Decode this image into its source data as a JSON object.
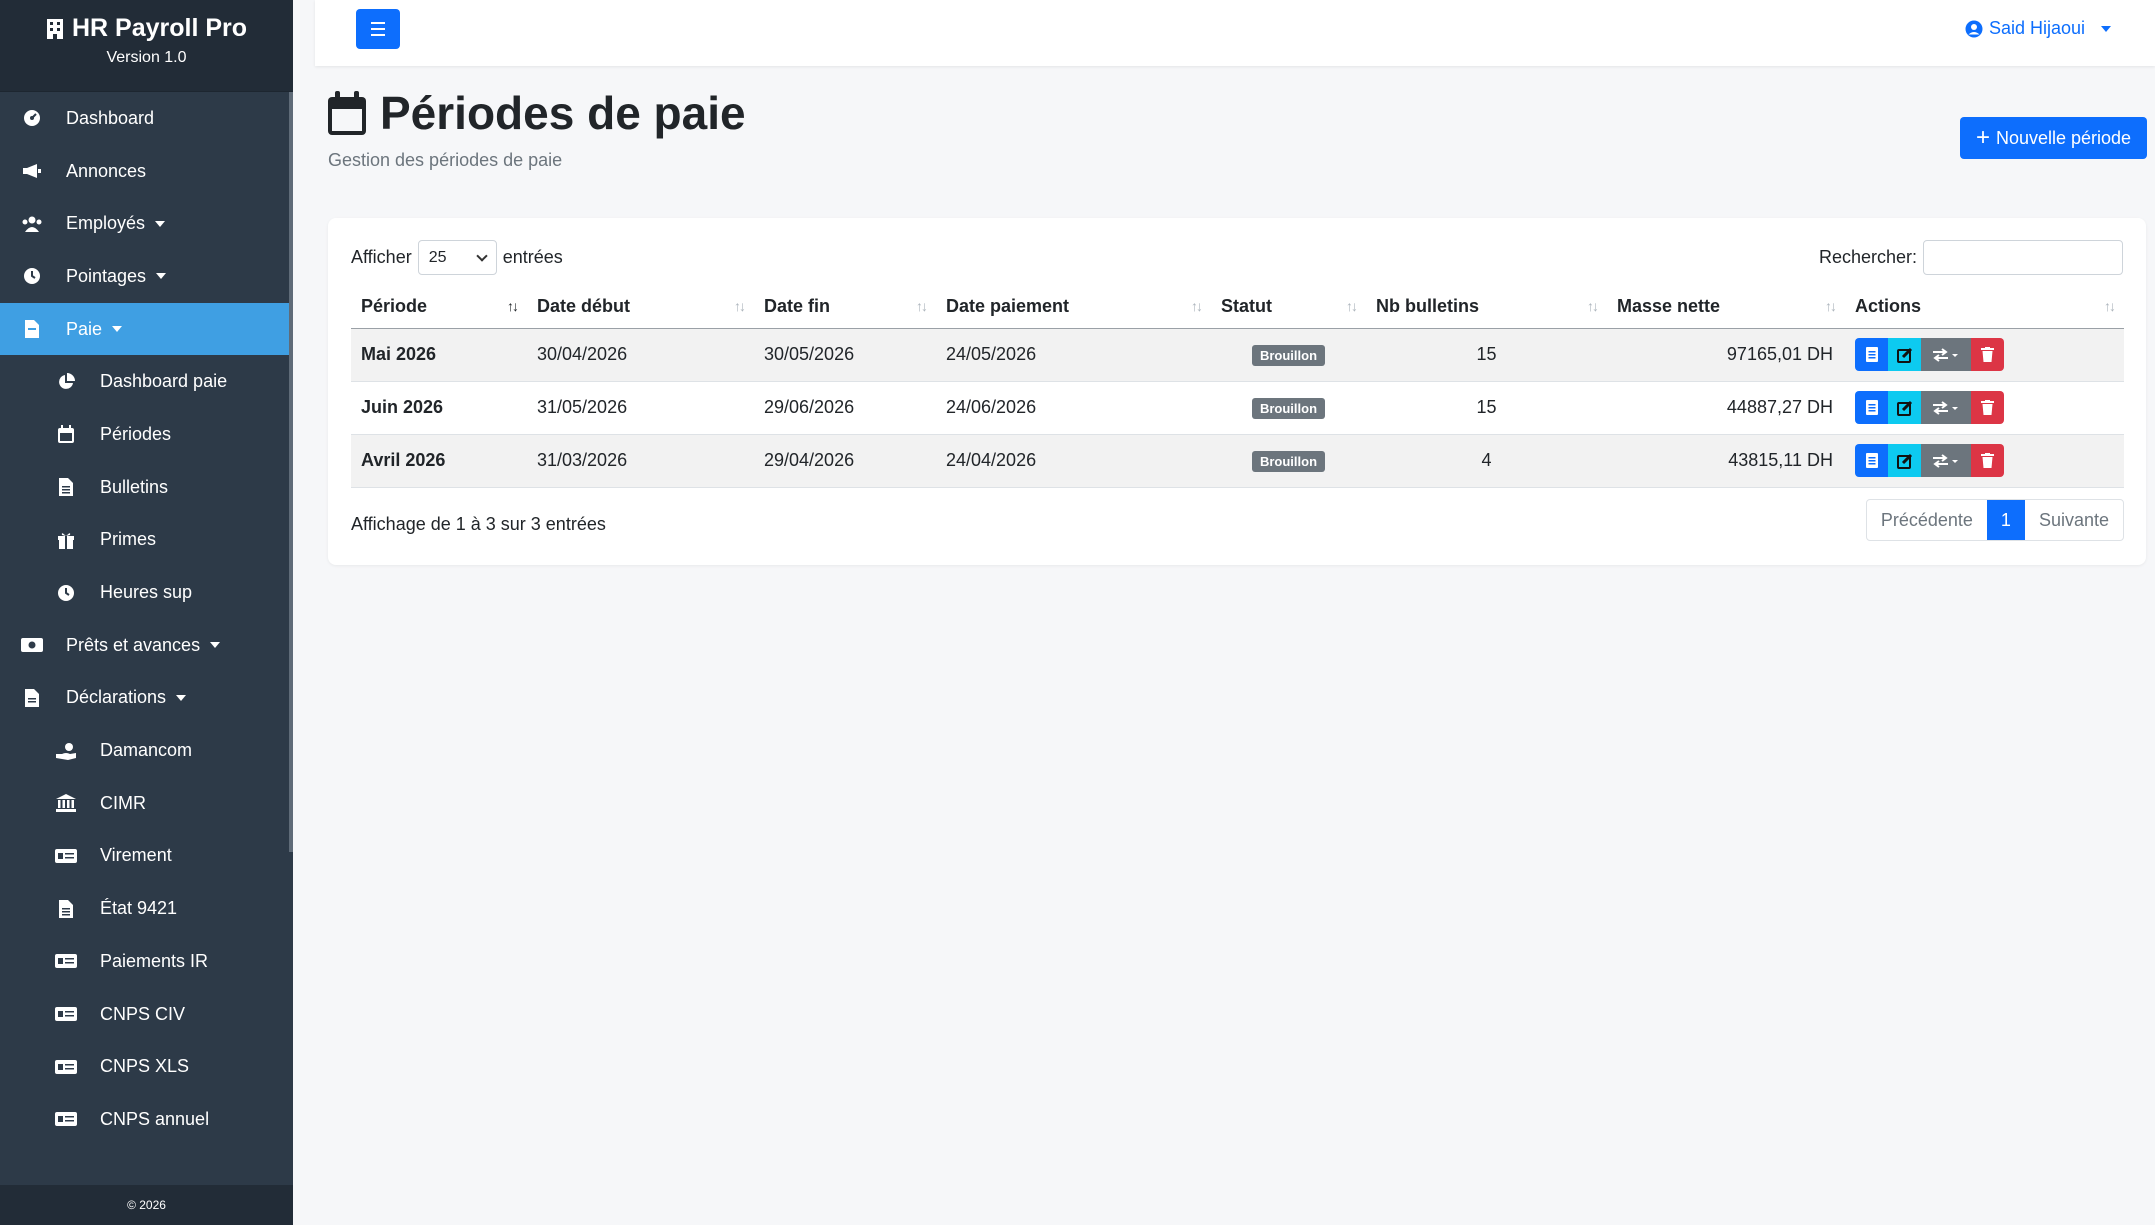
{
  "brand": {
    "title": "HR Payroll Pro",
    "version": "Version 1.0"
  },
  "sidebar": {
    "items": [
      {
        "label": "Dashboard",
        "icon": "gauge-icon",
        "sub": false,
        "caret": false
      },
      {
        "label": "Annonces",
        "icon": "megaphone-icon",
        "sub": false,
        "caret": false
      },
      {
        "label": "Employés",
        "icon": "users-icon",
        "sub": false,
        "caret": true
      },
      {
        "label": "Pointages",
        "icon": "clock-icon",
        "sub": false,
        "caret": true
      },
      {
        "label": "Paie",
        "icon": "file-invoice-icon",
        "sub": false,
        "caret": true,
        "active": true
      },
      {
        "label": "Dashboard paie",
        "icon": "pie-chart-icon",
        "sub": true
      },
      {
        "label": "Périodes",
        "icon": "calendar-icon",
        "sub": true
      },
      {
        "label": "Bulletins",
        "icon": "file-lines-icon",
        "sub": true
      },
      {
        "label": "Primes",
        "icon": "gift-icon",
        "sub": true
      },
      {
        "label": "Heures sup",
        "icon": "clock-icon",
        "sub": true
      },
      {
        "label": "Prêts et avances",
        "icon": "money-bill-icon",
        "sub": false,
        "caret": true
      },
      {
        "label": "Déclarations",
        "icon": "file-alt-icon",
        "sub": false,
        "caret": true
      },
      {
        "label": "Damancom",
        "icon": "hand-holding-icon",
        "sub": true
      },
      {
        "label": "CIMR",
        "icon": "bank-icon",
        "sub": true
      },
      {
        "label": "Virement",
        "icon": "money-check-icon",
        "sub": true
      },
      {
        "label": "État 9421",
        "icon": "file-lines-icon",
        "sub": true
      },
      {
        "label": "Paiements IR",
        "icon": "money-check-icon",
        "sub": true
      },
      {
        "label": "CNPS CIV",
        "icon": "money-check-icon",
        "sub": true
      },
      {
        "label": "CNPS XLS",
        "icon": "money-check-icon",
        "sub": true
      },
      {
        "label": "CNPS annuel",
        "icon": "money-check-icon",
        "sub": true
      }
    ],
    "footer": "© 2026"
  },
  "topbar": {
    "user": "Said Hijaoui"
  },
  "header": {
    "title": "Périodes de paie",
    "subtitle": "Gestion des périodes de paie",
    "new_button": "Nouvelle période"
  },
  "table": {
    "length_label": "Afficher",
    "length_value": "25",
    "length_suffix": "entrées",
    "search_label": "Rechercher:",
    "columns": [
      "Période",
      "Date début",
      "Date fin",
      "Date paiement",
      "Statut",
      "Nb bulletins",
      "Masse nette",
      "Actions"
    ],
    "rows": [
      {
        "periode": "Mai 2026",
        "debut": "30/04/2026",
        "fin": "30/05/2026",
        "paiement": "24/05/2026",
        "statut": "Brouillon",
        "nb": "15",
        "masse": "97165,01 DH"
      },
      {
        "periode": "Juin 2026",
        "debut": "31/05/2026",
        "fin": "29/06/2026",
        "paiement": "24/06/2026",
        "statut": "Brouillon",
        "nb": "15",
        "masse": "44887,27 DH"
      },
      {
        "periode": "Avril 2026",
        "debut": "31/03/2026",
        "fin": "29/04/2026",
        "paiement": "24/04/2026",
        "statut": "Brouillon",
        "nb": "4",
        "masse": "43815,11 DH"
      }
    ],
    "info": "Affichage de 1 à 3 sur 3 entrées",
    "pager": {
      "prev": "Précédente",
      "current": "1",
      "next": "Suivante"
    }
  },
  "colors": {
    "primary": "#0d6efd",
    "sidebar": "#2d3a48",
    "active": "#3f9fe3",
    "info": "#0dcaf0",
    "danger": "#dc3545",
    "secondary": "#6c757d"
  }
}
